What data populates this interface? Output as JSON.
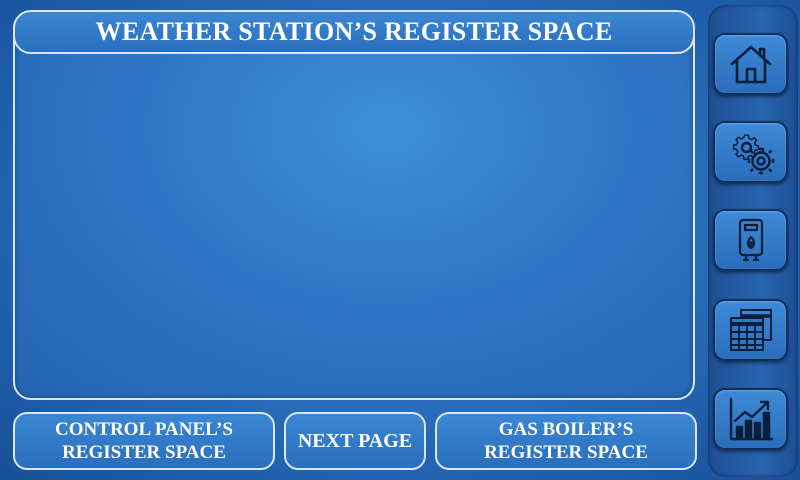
{
  "title": "WEATHER STATION’S REGISTER SPACE",
  "sidebar": {
    "items": [
      {
        "icon": "home-icon"
      },
      {
        "icon": "settings-gears-icon"
      },
      {
        "icon": "gas-boiler-icon"
      },
      {
        "icon": "calendar-grid-icon"
      },
      {
        "icon": "bar-chart-trend-icon"
      }
    ]
  },
  "footer": {
    "control_panel": {
      "line1": "CONTROL PANEL’S",
      "line2": "REGISTER SPACE"
    },
    "next_page": "NEXT PAGE",
    "gas_boiler": {
      "line1": "GAS BOILER’S",
      "line2": "REGISTER SPACE"
    }
  },
  "colors": {
    "background": "#2d72bf",
    "border": "#d9e6f5",
    "text": "#ffffff",
    "icon": "#0b1f3d"
  }
}
